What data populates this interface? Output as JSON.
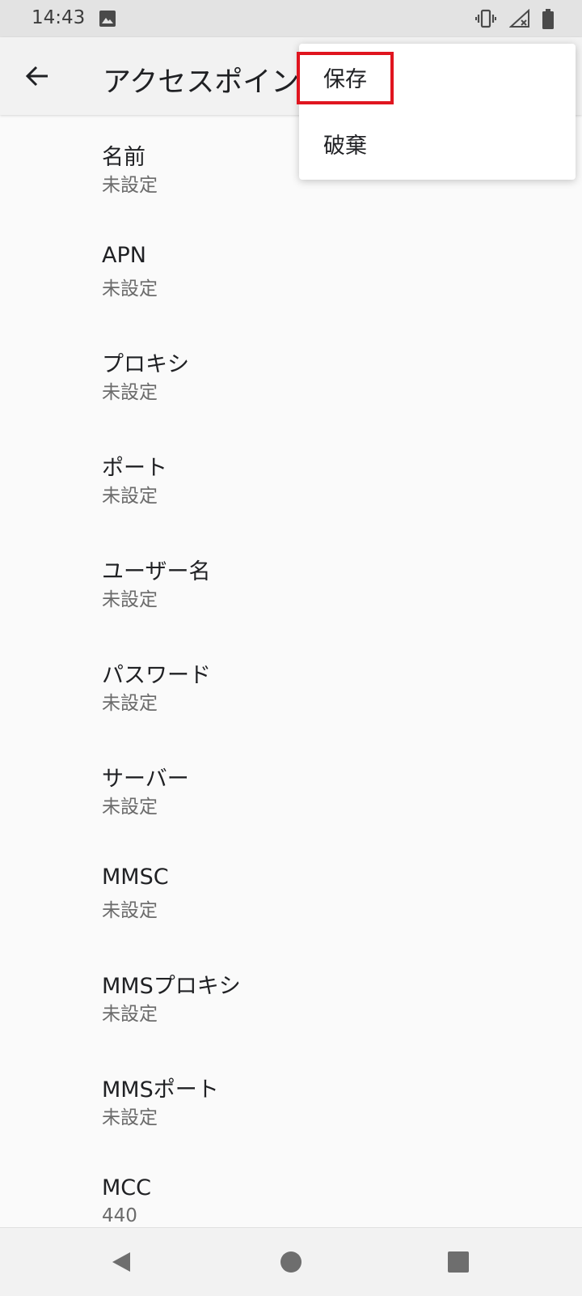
{
  "status_bar": {
    "time": "14:43",
    "icons": [
      "gallery-icon",
      "vibrate-icon",
      "signal-off-icon",
      "battery-icon"
    ]
  },
  "app_bar": {
    "title": "アクセスポイントの編集",
    "back_icon": "arrow-back-icon"
  },
  "overflow_menu": {
    "items": [
      {
        "label": "保存",
        "highlighted": true
      },
      {
        "label": "破棄",
        "highlighted": false
      }
    ],
    "highlight_color": "#e0151f"
  },
  "settings": {
    "items": [
      {
        "title": "名前",
        "summary": "未設定"
      },
      {
        "title": "APN",
        "summary": "未設定"
      },
      {
        "title": "プロキシ",
        "summary": "未設定"
      },
      {
        "title": "ポート",
        "summary": "未設定"
      },
      {
        "title": "ユーザー名",
        "summary": "未設定"
      },
      {
        "title": "パスワード",
        "summary": "未設定"
      },
      {
        "title": "サーバー",
        "summary": "未設定"
      },
      {
        "title": "MMSC",
        "summary": "未設定"
      },
      {
        "title": "MMSプロキシ",
        "summary": "未設定"
      },
      {
        "title": "MMSポート",
        "summary": "未設定"
      },
      {
        "title": "MCC",
        "summary": "440"
      }
    ]
  },
  "nav_bar": {
    "icons": [
      "nav-back-icon",
      "nav-home-icon",
      "nav-recents-icon"
    ]
  },
  "colors": {
    "background": "#fafafa",
    "status_bar": "#e3e3e3",
    "app_bar": "#f2f2f2",
    "summary_text": "#6b6b6b"
  }
}
